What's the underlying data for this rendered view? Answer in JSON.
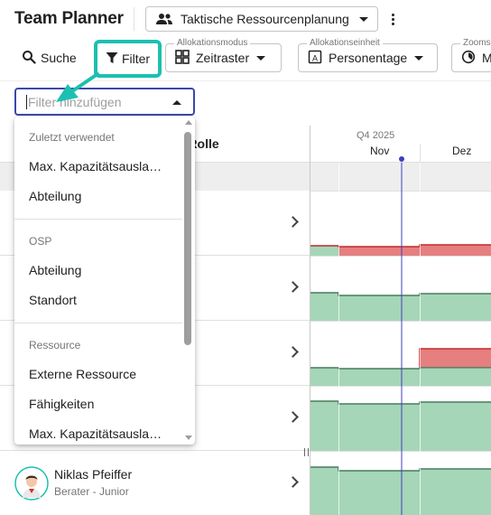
{
  "header": {
    "title": "Team Planner",
    "planner_select": {
      "value": "Taktische Ressourcenplanung",
      "icon": "people-icon"
    },
    "more_icon": "more-vert-icon"
  },
  "toolbar": {
    "search": {
      "label": "Suche",
      "icon": "search-icon"
    },
    "filter": {
      "label": "Filter",
      "icon": "filter-icon",
      "highlight_color": "#1cc0b0"
    },
    "allocation_mode": {
      "legend": "Allokationsmodus",
      "value": "Zeitraster",
      "icon": "grid-icon"
    },
    "allocation_unit": {
      "legend": "Allokationseinheit",
      "value": "Personentage",
      "icon": "calendar-day-icon"
    },
    "zoom": {
      "legend": "Zooms",
      "value": "M",
      "icon": "timelapse-icon"
    }
  },
  "filter_input": {
    "placeholder": "Filter hinzufügen",
    "border_color": "#3949ab"
  },
  "dropdown": {
    "sections": [
      {
        "title": "Zuletzt verwendet",
        "items": [
          "Max. Kapazitätsausla…",
          "Abteilung"
        ]
      },
      {
        "title": "OSP",
        "items": [
          "Abteilung",
          "Standort"
        ]
      },
      {
        "title": "Ressource",
        "items": [
          "Externe Ressource",
          "Fähigkeiten",
          "Max. Kapazitätsausla…"
        ]
      }
    ]
  },
  "table": {
    "column_header_partial": "n Rolle",
    "rows": [
      {
        "name": "",
        "role": ""
      },
      {
        "name": "",
        "role": ""
      },
      {
        "name": "",
        "role": ""
      },
      {
        "name": "",
        "role": ""
      },
      {
        "name": "Niklas Pfeiffer",
        "role": "Berater - Junior"
      }
    ]
  },
  "timeline": {
    "quarter": "Q4 2025",
    "months": [
      "Nov",
      "Dez"
    ],
    "colors": {
      "ok_fill": "#a5d6b8",
      "ok_stroke": "#4a7a5c",
      "over_fill": "#e57f80",
      "over_stroke": "#c62828",
      "today_line": "#3f3fbf"
    }
  }
}
